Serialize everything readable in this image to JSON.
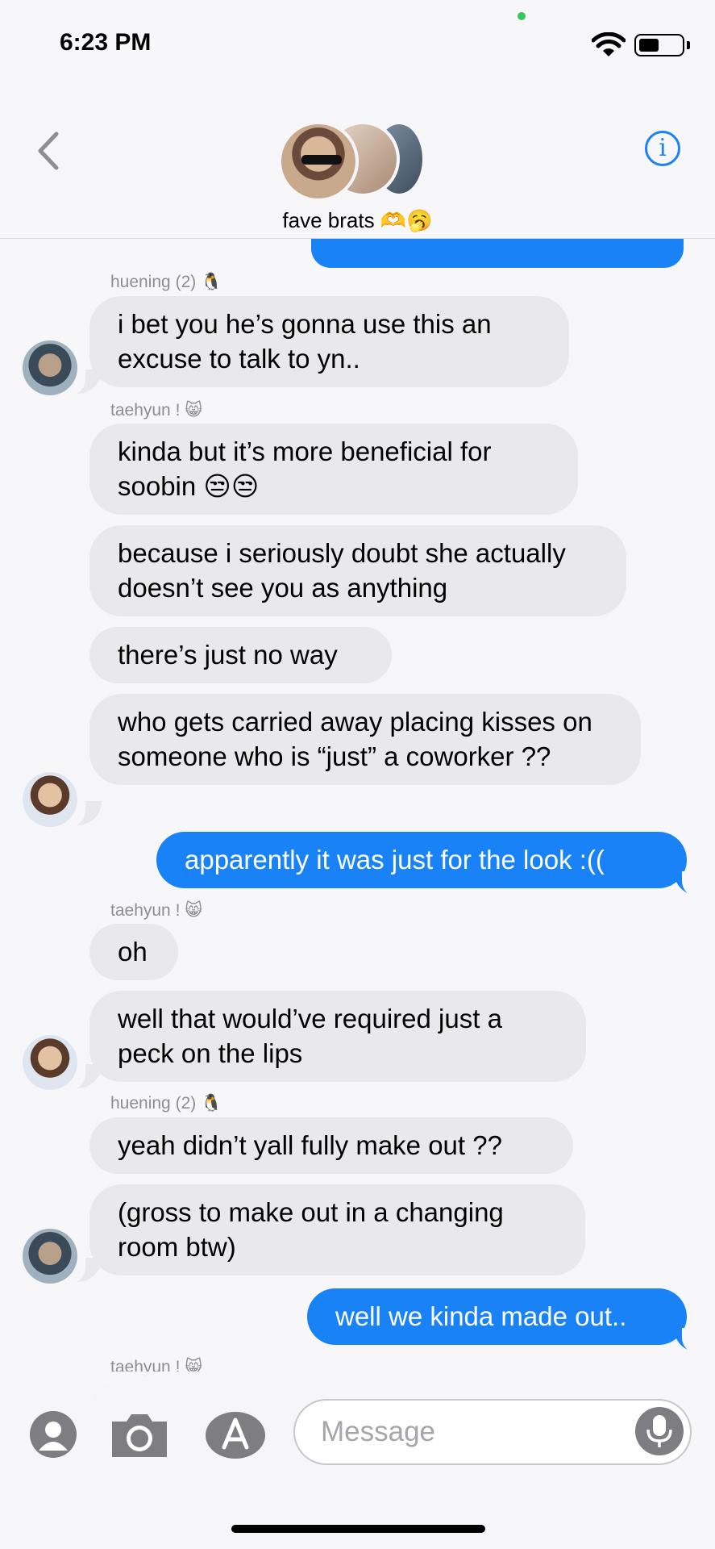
{
  "status": {
    "time": "6:23 PM"
  },
  "header": {
    "group_name": "fave brats 🫶🥱"
  },
  "messages": [
    {
      "sender": "huening (2) 🐧",
      "text": "i bet you he’s gonna use this an excuse to talk to yn.."
    },
    {
      "sender": "taehyun ! 😸",
      "text": "kinda but it’s more beneficial for soobin 😒😒"
    },
    {
      "text": "because i seriously doubt she actually doesn’t see you as anything"
    },
    {
      "text": "there’s just no way"
    },
    {
      "text": "who gets carried away placing kisses on someone who is “just” a coworker ??"
    },
    {
      "text": "apparently it was just for the look :(("
    },
    {
      "sender": "taehyun ! 😸",
      "text": "oh"
    },
    {
      "text": "well that would’ve required just a peck on the lips"
    },
    {
      "sender": "huening (2) 🐧",
      "text": "yeah didn’t yall fully make out ??"
    },
    {
      "text": "(gross to make out in a changing room btw)"
    },
    {
      "text": "well we kinda made out.."
    },
    {
      "sender": "taehyun ! 😸"
    }
  ],
  "input": {
    "placeholder": "Message"
  },
  "icons": [
    "back-chevron-icon",
    "info-icon",
    "wifi-icon",
    "battery-icon",
    "contact-icon",
    "camera-icon",
    "app-store-icon",
    "microphone-icon"
  ],
  "colors": {
    "accent": "#1a82f7",
    "incoming_bubble": "#e9e9eb",
    "background": "#f7f7f9"
  }
}
